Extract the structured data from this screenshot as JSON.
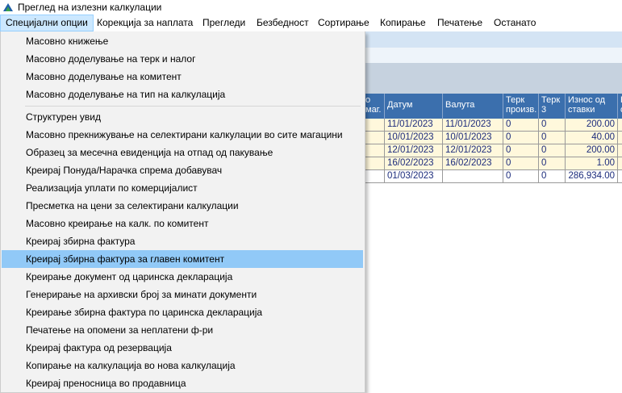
{
  "window": {
    "title": "Преглед на излезни калкулации"
  },
  "menubar": [
    {
      "label": "Специјални опции",
      "active": true
    },
    {
      "label": "Корекција за наплата"
    },
    {
      "label": "Прегледи"
    },
    {
      "label": "Безбедност"
    },
    {
      "label": "Сортирање"
    },
    {
      "label": "Копирање"
    },
    {
      "label": "Печатење"
    },
    {
      "label": "Останато"
    }
  ],
  "dropdown": {
    "group1": [
      "Масовно книжење",
      "Масовно доделување на терк и налог",
      "Масовно доделување на комитент",
      "Масовно доделување  на тип на калкулација"
    ],
    "group2": [
      "Структурен увид",
      "Масовно прекнижување на селектирани калкулации во сите магацини",
      "Образец за месечна евиденција на отпад од пакување",
      "Креирај Понуда/Нарачка спрема добавувач",
      "Реализација уплати по комерцијалист",
      "Пресметка на цени за селектирани калкулации",
      "Масовно креирање на калк. по комитент",
      "Креирај збирна фактура",
      "Креирај збирна фактура за главен комитент",
      "Креирање документ од царинска декларација",
      "Генерирање на архивски број за минати документи",
      "Креирање збирна фактура по царинска декларација",
      "Печатење на опомени за неплатени ф-ри",
      "Креирај фактура од резервација",
      "Копирање на калкулација во нова калкулација",
      "Креирај преносница во продавница"
    ],
    "highlighted": "Креирај збирна фактура за главен комитент"
  },
  "grid": {
    "headers": [
      "о\nмаг.",
      "Датум",
      "Валута",
      "Терк\nпроизв.",
      "Терк\n3",
      "Износ од\nставки",
      "К\nс"
    ],
    "rows": [
      [
        "",
        "11/01/2023",
        "11/01/2023",
        "0",
        "0",
        "200.00",
        ""
      ],
      [
        "",
        "10/01/2023",
        "10/01/2023",
        "0",
        "0",
        "40.00",
        ""
      ],
      [
        "",
        "12/01/2023",
        "12/01/2023",
        "0",
        "0",
        "200.00",
        ""
      ],
      [
        "",
        "16/02/2023",
        "16/02/2023",
        "0",
        "0",
        "1.00",
        ""
      ],
      [
        "",
        "01/03/2023",
        "",
        "0",
        "0",
        "286,934.00",
        ""
      ]
    ]
  }
}
